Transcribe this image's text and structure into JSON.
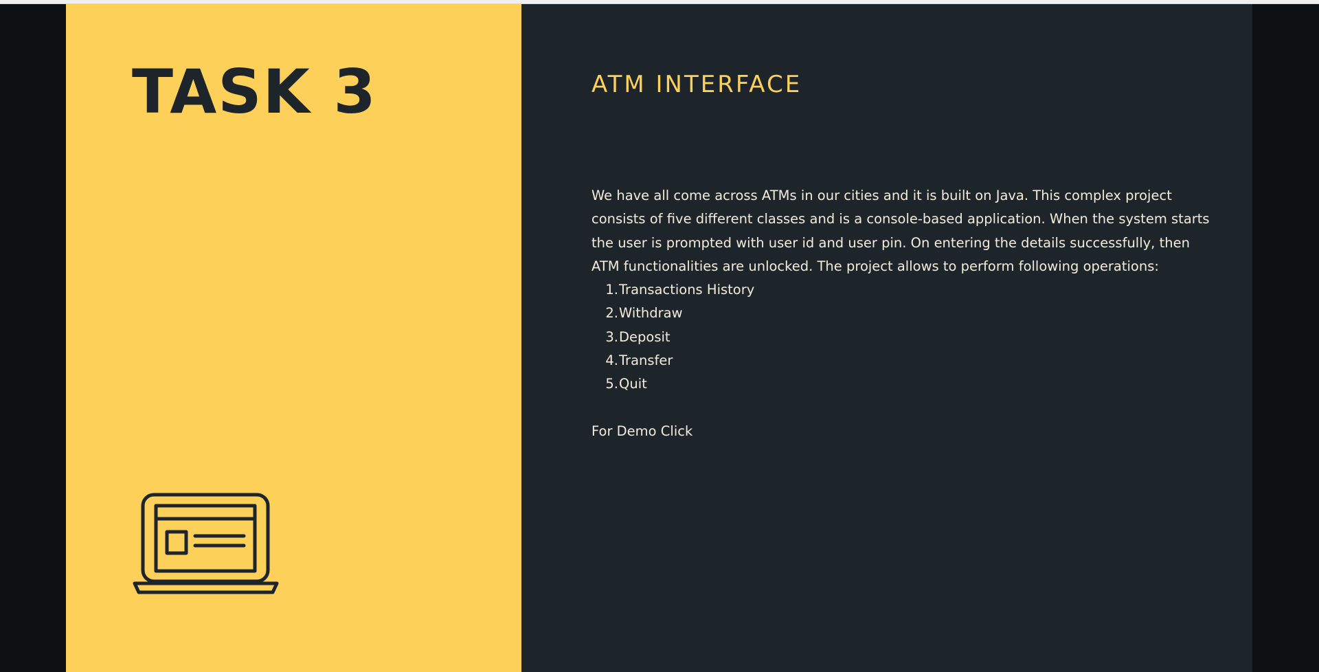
{
  "left": {
    "title": "TASK 3",
    "icon": "laptop-card-icon"
  },
  "right": {
    "title": "ATM INTERFACE",
    "description": "We have all come across ATMs in our cities and it is built on Java. This complex project consists of five different classes and is a console-based application. When the system starts the user is prompted with user id and user pin. On entering the details successfully, then ATM functionalities are unlocked. The project allows to perform following operations:",
    "operations": [
      {
        "num": "1.",
        "label": "Transactions History"
      },
      {
        "num": "2.",
        "label": "Withdraw"
      },
      {
        "num": "3.",
        "label": "Deposit"
      },
      {
        "num": "4.",
        "label": "Transfer"
      },
      {
        "num": "5.",
        "label": "Quit"
      }
    ],
    "demo_label": "For Demo Click"
  },
  "colors": {
    "accent_yellow": "#fdd05a",
    "panel_dark": "#1e252a",
    "outer_dark": "#0c1013",
    "text_light": "#f3ecdd"
  }
}
